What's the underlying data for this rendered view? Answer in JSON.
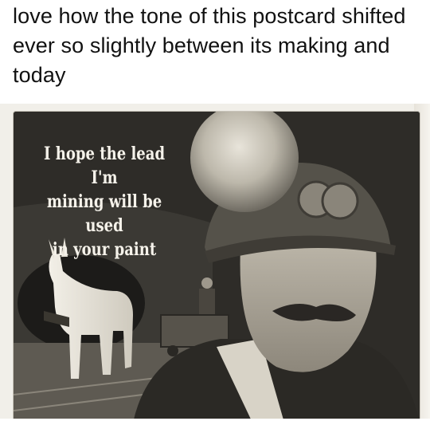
{
  "post": {
    "caption": "love how the tone of this postcard shifted ever so slightly between its making and today"
  },
  "postcard": {
    "slogan_lines": [
      "I hope the lead I'm",
      "mining will be used",
      "in your paint"
    ]
  },
  "colors": {
    "caption_text": "#111111",
    "postcard_background": "#2f2d29",
    "slogan_text": "#f5f2ea"
  }
}
